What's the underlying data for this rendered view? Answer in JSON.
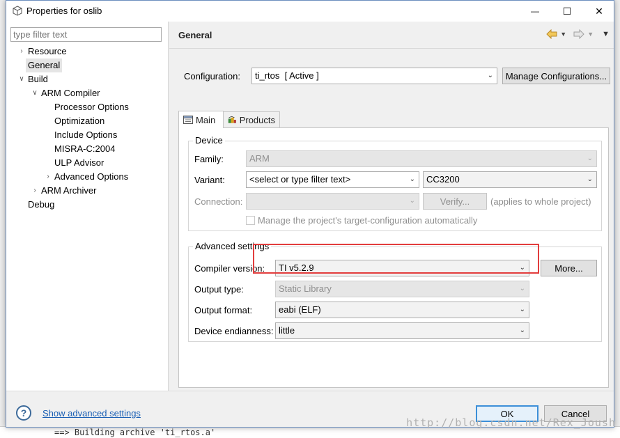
{
  "window": {
    "title": "Properties for oslib",
    "minimize": "—",
    "maximize": "☐",
    "close": "✕"
  },
  "filter": {
    "placeholder": "type filter text"
  },
  "tree": [
    {
      "label": "Resource",
      "indent": 0,
      "twisty": "›"
    },
    {
      "label": "General",
      "indent": 0,
      "twisty": "",
      "selected": true
    },
    {
      "label": "Build",
      "indent": 0,
      "twisty": "∨"
    },
    {
      "label": "ARM Compiler",
      "indent": 1,
      "twisty": "∨"
    },
    {
      "label": "Processor Options",
      "indent": 2,
      "twisty": ""
    },
    {
      "label": "Optimization",
      "indent": 2,
      "twisty": ""
    },
    {
      "label": "Include Options",
      "indent": 2,
      "twisty": ""
    },
    {
      "label": "MISRA-C:2004",
      "indent": 2,
      "twisty": ""
    },
    {
      "label": "ULP Advisor",
      "indent": 2,
      "twisty": ""
    },
    {
      "label": "Advanced Options",
      "indent": 2,
      "twisty": "›"
    },
    {
      "label": "ARM Archiver",
      "indent": 1,
      "twisty": "›"
    },
    {
      "label": "Debug",
      "indent": 0,
      "twisty": ""
    }
  ],
  "panel": {
    "title": "General",
    "configuration_label": "Configuration:",
    "configuration_value": "ti_rtos  [ Active ]",
    "manage_button": "Manage Configurations...",
    "tabs": [
      {
        "label": "Main",
        "icon": "main-tab-icon"
      },
      {
        "label": "Products",
        "icon": "products-tab-icon"
      }
    ]
  },
  "device": {
    "title": "Device",
    "family_label": "Family:",
    "family_value": "ARM",
    "variant_label": "Variant:",
    "variant_filter": "<select or type filter text>",
    "variant_value": "CC3200",
    "connection_label": "Connection:",
    "connection_value": "",
    "verify_button": "Verify...",
    "applies_note": "(applies to whole project)",
    "manage_checkbox": "Manage the project's target-configuration automatically"
  },
  "advanced": {
    "title": "Advanced settings",
    "compiler_label": "Compiler version:",
    "compiler_value": "TI v5.2.9",
    "more_button": "More...",
    "output_type_label": "Output type:",
    "output_type_value": "Static Library",
    "output_format_label": "Output format:",
    "output_format_value": "eabi (ELF)",
    "endianness_label": "Device endianness:",
    "endianness_value": "little"
  },
  "footer": {
    "help": "?",
    "show_advanced": "Show advanced settings",
    "ok": "OK",
    "cancel": "Cancel"
  },
  "background": {
    "console_line": "==> Building archive 'ti_rtos.a'"
  },
  "watermark": "http://blog.csdn.net/Rex_Joush",
  "colors": {
    "highlight": "#e23d3d",
    "link": "#1a5fb4",
    "primary_border": "#3c8fd8"
  }
}
